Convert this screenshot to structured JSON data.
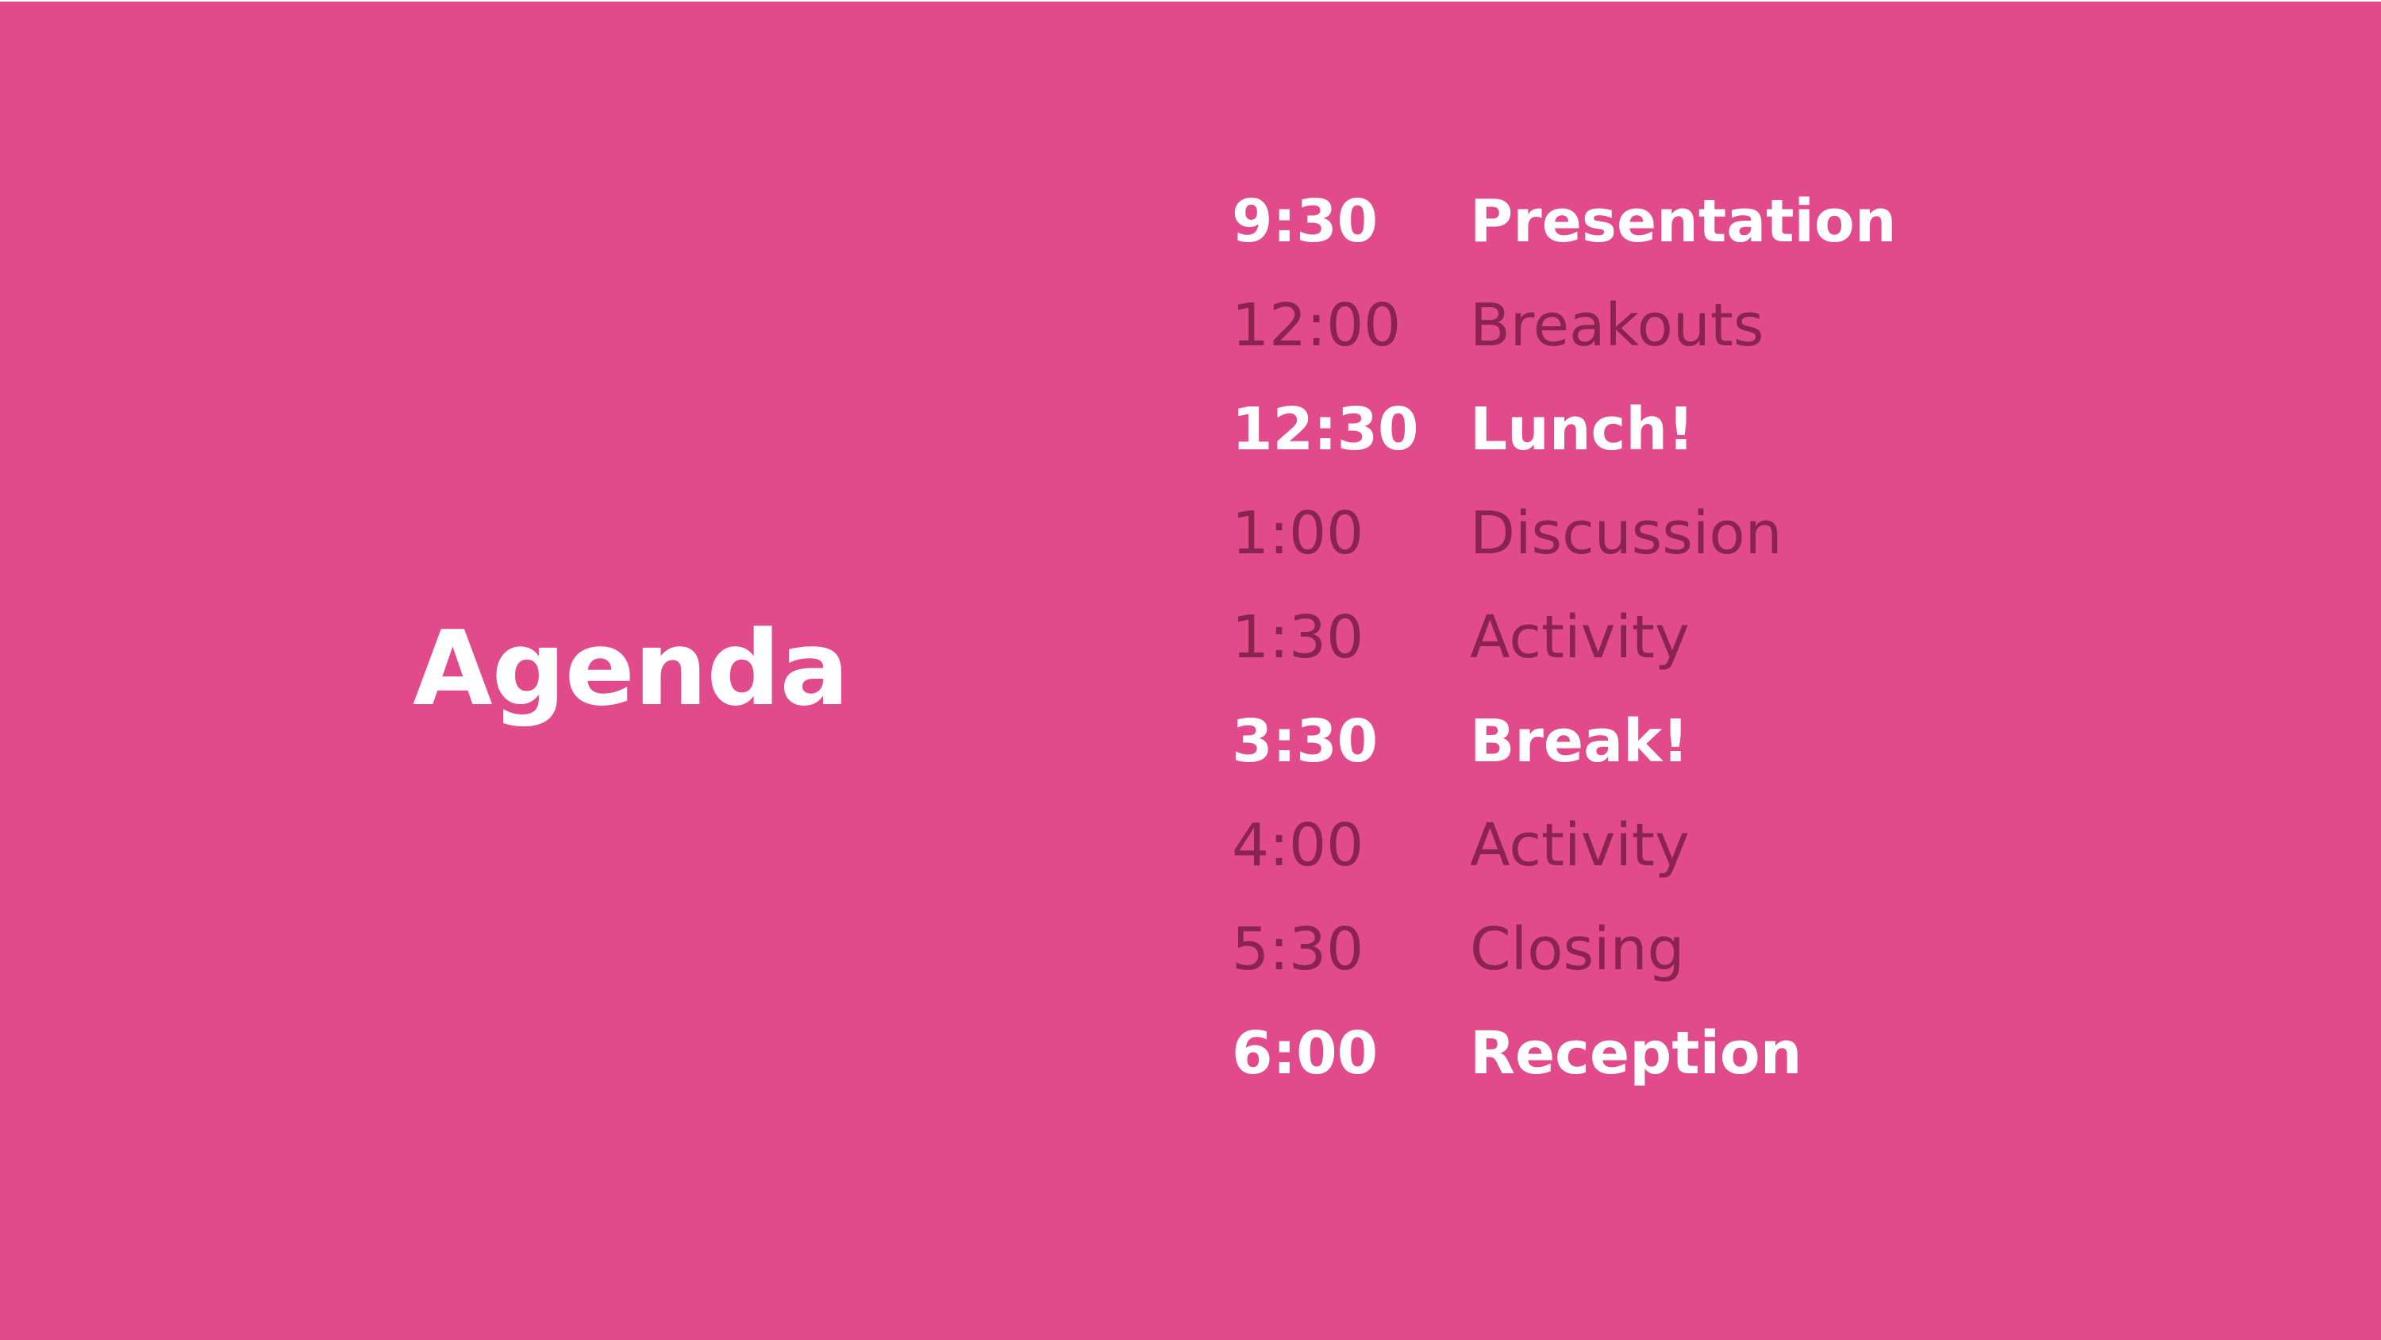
{
  "theme": {
    "background": "#e24b8b",
    "highlight_text": "#ffffff",
    "muted_text": "#8a2352"
  },
  "title": "Agenda",
  "agenda": [
    {
      "time": "9:30",
      "activity": "Presentation",
      "highlight": true
    },
    {
      "time": "12:00",
      "activity": "Breakouts",
      "highlight": false
    },
    {
      "time": "12:30",
      "activity": "Lunch!",
      "highlight": true
    },
    {
      "time": "1:00",
      "activity": "Discussion",
      "highlight": false
    },
    {
      "time": "1:30",
      "activity": "Activity",
      "highlight": false
    },
    {
      "time": "3:30",
      "activity": "Break!",
      "highlight": true
    },
    {
      "time": "4:00",
      "activity": "Activity",
      "highlight": false
    },
    {
      "time": "5:30",
      "activity": "Closing",
      "highlight": false
    },
    {
      "time": "6:00",
      "activity": "Reception",
      "highlight": true
    }
  ]
}
